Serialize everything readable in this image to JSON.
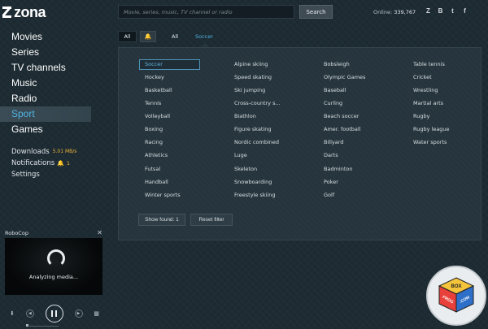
{
  "app": {
    "logo": "zona"
  },
  "search": {
    "placeholder": "Movie, series, music, TV channel or radio",
    "value": "",
    "button_label": "Search"
  },
  "online": {
    "label": "Online:",
    "count": "339,767"
  },
  "socials": [
    "Z",
    "B",
    "t",
    "f"
  ],
  "nav": {
    "items": [
      "Movies",
      "Series",
      "TV channels",
      "Music",
      "Radio",
      "Sport",
      "Games"
    ],
    "active": "Sport"
  },
  "utilities": {
    "downloads_label": "Downloads",
    "downloads_speed": "5.01 MB/s",
    "notifications_label": "Notifications",
    "notifications_count": "1",
    "settings_label": "Settings"
  },
  "player": {
    "title": "RoboCop",
    "status": "Analyzing media..."
  },
  "filter": {
    "all_label": "All",
    "crumb_all": "All",
    "crumb_current": "Soccer"
  },
  "genres": {
    "columns": [
      [
        "Soccer",
        "Hockey",
        "Basketball",
        "Tennis",
        "Volleyball",
        "Boxing",
        "Racing",
        "Athletics",
        "Futsal",
        "Handball",
        "Winter sports"
      ],
      [
        "Alpine skiing",
        "Speed skating",
        "Ski jumping",
        "Cross-country s...",
        "Biathlon",
        "Figure skating",
        "Nordic combined",
        "Luge",
        "Skeleton",
        "Snowboarding",
        "Freestyle skiing"
      ],
      [
        "Bobsleigh",
        "Olympic Games",
        "Baseball",
        "Curling",
        "Beach soccer",
        "Amer. football",
        "Billyard",
        "Darts",
        "Badminton",
        "Poker",
        "Golf"
      ],
      [
        "Table tennis",
        "Cricket",
        "Wrestling",
        "Martial arts",
        "Rugby",
        "Rugby league",
        "Water sports"
      ]
    ],
    "selected": "Soccer",
    "show_found_label": "Show found: 1",
    "reset_label": "Reset filter"
  },
  "watermark": {
    "line1": "BOX",
    "line2": "PROG",
    "line3": ".COM"
  },
  "colors": {
    "accent": "#4fb4e3",
    "panel": "#26353d",
    "background": "#1d2b33",
    "highlight": "#f0b43a"
  }
}
